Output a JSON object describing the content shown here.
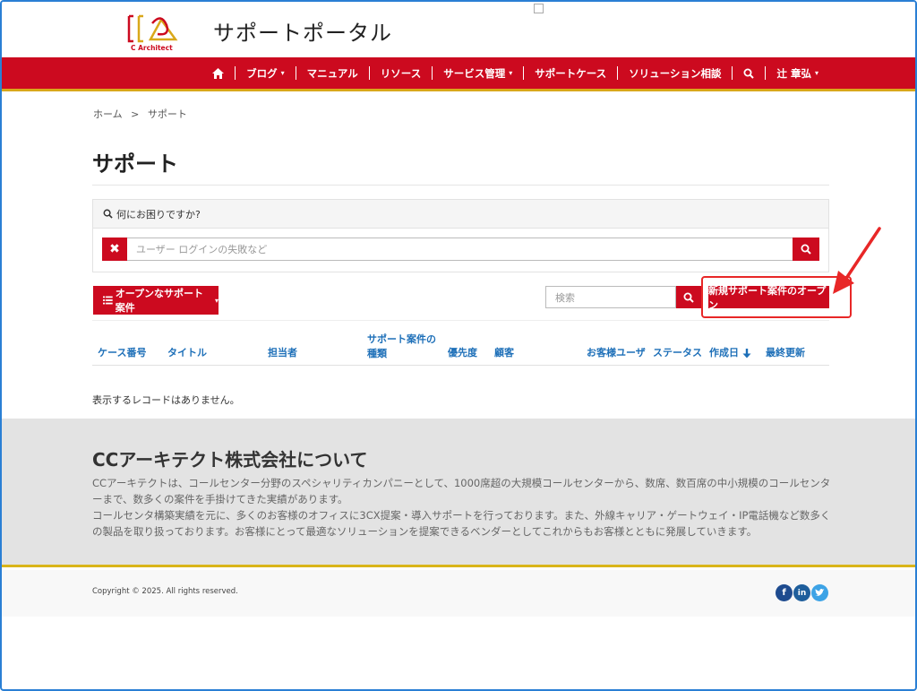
{
  "header": {
    "site_title": "サポートポータル",
    "logo_label": "C Architect"
  },
  "nav": {
    "items": [
      {
        "label": "ブログ",
        "dropdown": true
      },
      {
        "label": "マニュアル",
        "dropdown": false
      },
      {
        "label": "リソース",
        "dropdown": false
      },
      {
        "label": "サービス管理",
        "dropdown": true
      },
      {
        "label": "サポートケース",
        "dropdown": false
      },
      {
        "label": "ソリューション相談",
        "dropdown": false
      }
    ],
    "user": "辻 章弘",
    "caret": "▾"
  },
  "breadcrumb": {
    "home": "ホーム",
    "separator": ">",
    "current": "サポート"
  },
  "page_title": "サポート",
  "search_panel": {
    "heading": "何にお困りですか?",
    "placeholder": "ユーザー ログインの失敗など"
  },
  "toolbar": {
    "filter_label": "オープンなサポート案件",
    "search_placeholder": "検索",
    "new_case_label": "新規サポート案件のオープン"
  },
  "table": {
    "columns": [
      "ケース番号",
      "タイトル",
      "担当者",
      "サポート案件の種類",
      "優先度",
      "顧客",
      "お客様ユーザ",
      "ステータス",
      "作成日",
      "最終更新"
    ],
    "empty_message": "表示するレコードはありません。"
  },
  "about": {
    "title": "CCアーキテクト株式会社について",
    "paragraph1": "CCアーキテクトは、コールセンター分野のスペシャリティカンパニーとして、1000席超の大規模コールセンターから、数席、数百席の中小規模のコールセンターまで、数多くの案件を手掛けてきた実績があります。",
    "paragraph2": "コールセンタ構築実績を元に、多くのお客様のオフィスに3CX提案・導入サポートを行っております。また、外線キャリア・ゲートウェイ・IP電話機など数多くの製品を取り扱っております。お客様にとって最適なソリューションを提案できるベンダーとしてこれからもお客様とともに発展していきます。"
  },
  "footer": {
    "copyright": "Copyright © 2025. All rights reserved."
  },
  "colors": {
    "brand_red": "#cc0a1f",
    "accent_gold": "#d9a81a",
    "link_blue": "#1d6fb8"
  }
}
